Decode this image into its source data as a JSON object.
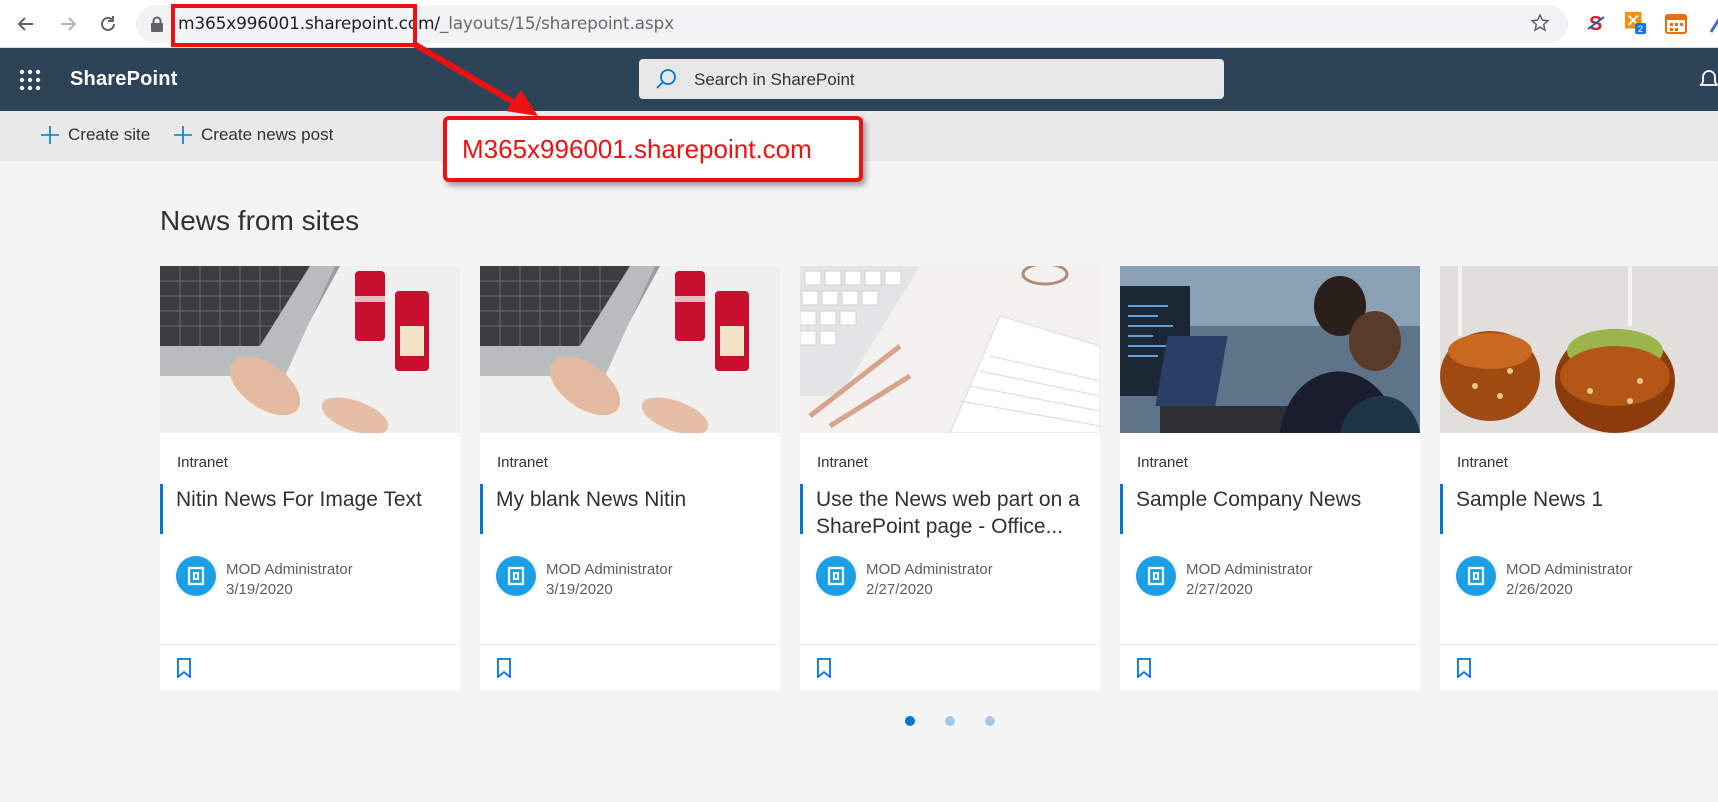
{
  "browser": {
    "url_host": "m365x996001.sharepoint.com/",
    "url_path": "_layouts/15/sharepoint.aspx"
  },
  "suite": {
    "brand": "SharePoint",
    "search_placeholder": "Search in SharePoint"
  },
  "commands": {
    "create_site": "Create site",
    "create_news": "Create news post"
  },
  "annotation": {
    "callout": "M365x996001.sharepoint.com"
  },
  "news": {
    "section_title": "News from sites",
    "cards": [
      {
        "site": "Intranet",
        "title": "Nitin News For Image Text",
        "author": "MOD Administrator",
        "date": "3/19/2020",
        "image": "laptop-coca-cola-photo"
      },
      {
        "site": "Intranet",
        "title": "My blank News Nitin",
        "author": "MOD Administrator",
        "date": "3/19/2020",
        "image": "laptop-coca-cola-photo"
      },
      {
        "site": "Intranet",
        "title": "Use the News web part on a SharePoint page - Office...",
        "author": "MOD Administrator",
        "date": "2/27/2020",
        "image": "keyboard-notebook-photo"
      },
      {
        "site": "Intranet",
        "title": "Sample Company News",
        "author": "MOD Administrator",
        "date": "2/27/2020",
        "image": "people-at-computer-photo"
      },
      {
        "site": "Intranet",
        "title": "Sample News 1",
        "author": "MOD Administrator",
        "date": "2/26/2020",
        "image": "caramel-apples-photo"
      }
    ],
    "pager": {
      "pages": 3,
      "active": 1
    }
  },
  "colors": {
    "suite_bar": "#2d4358",
    "accent": "#0078d4",
    "avatar": "#1aa0e6",
    "annotation_red": "#ee1111"
  },
  "icons": [
    "back-icon",
    "forward-icon",
    "reload-icon",
    "lock-icon",
    "star-icon",
    "waffle-icon",
    "search-icon",
    "bell-icon",
    "plus-icon",
    "bookmark-icon"
  ]
}
